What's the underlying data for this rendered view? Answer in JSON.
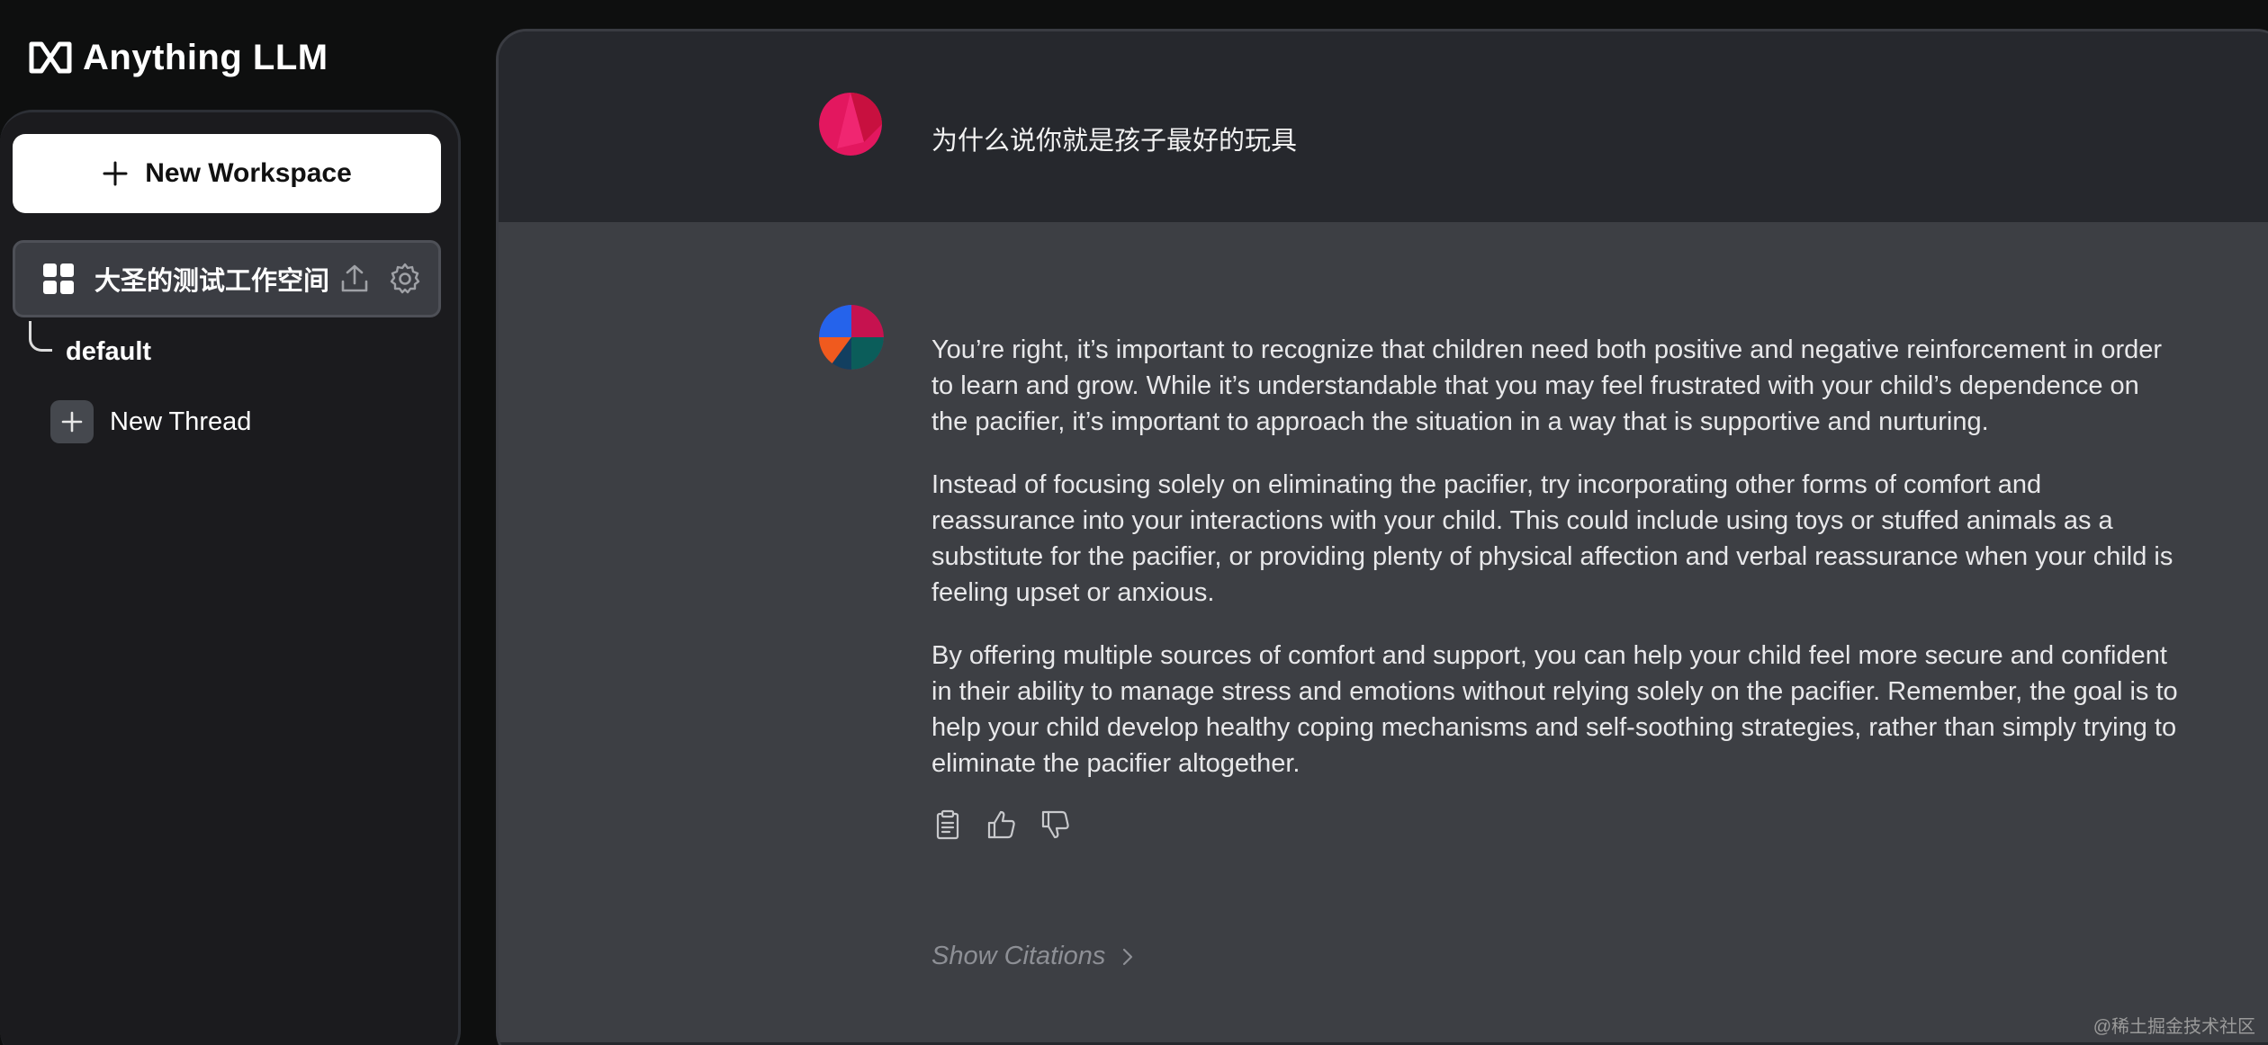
{
  "app": {
    "logo_text": "Anything LLM"
  },
  "sidebar": {
    "new_workspace_label": "New Workspace",
    "workspace": {
      "name": "大圣的测试工作空间",
      "icons": [
        "grid-icon",
        "upload-icon",
        "gear-icon"
      ]
    },
    "threads": [
      {
        "label": "default"
      }
    ],
    "new_thread_label": "New Thread"
  },
  "chat": {
    "user_message": "为什么说你就是孩子最好的玩具",
    "assistant_paragraphs": [
      "You’re right, it’s important to recognize that children need both positive and negative reinforcement in order to learn and grow. While it’s understandable that you may feel frustrated with your child’s dependence on the pacifier, it’s important to approach the situation in a way that is supportive and nurturing.",
      "Instead of focusing solely on eliminating the pacifier, try incorporating other forms of comfort and reassurance into your interactions with your child. This could include using toys or stuffed animals as a substitute for the pacifier, or providing plenty of physical affection and verbal reassurance when your child is feeling upset or anxious.",
      "By offering multiple sources of comfort and support, you can help your child feel more secure and confident in their ability to manage stress and emotions without relying solely on the pacifier. Remember, the goal is to help your child develop healthy coping mechanisms and self-soothing strategies, rather than simply trying to eliminate the pacifier altogether."
    ],
    "action_icons": [
      "clipboard-icon",
      "thumbs-up-icon",
      "thumbs-down-icon"
    ],
    "show_citations_label": "Show Citations"
  },
  "watermark": "@稀土掘金技术社区",
  "colors": {
    "background": "#0e0f0f",
    "sidebar": "#1b1b1e",
    "chat_user_row": "#26282d",
    "chat_assistant_row": "#3d3f44",
    "workspace_active": "#3b3d43",
    "button_primary": "#ffffff"
  }
}
